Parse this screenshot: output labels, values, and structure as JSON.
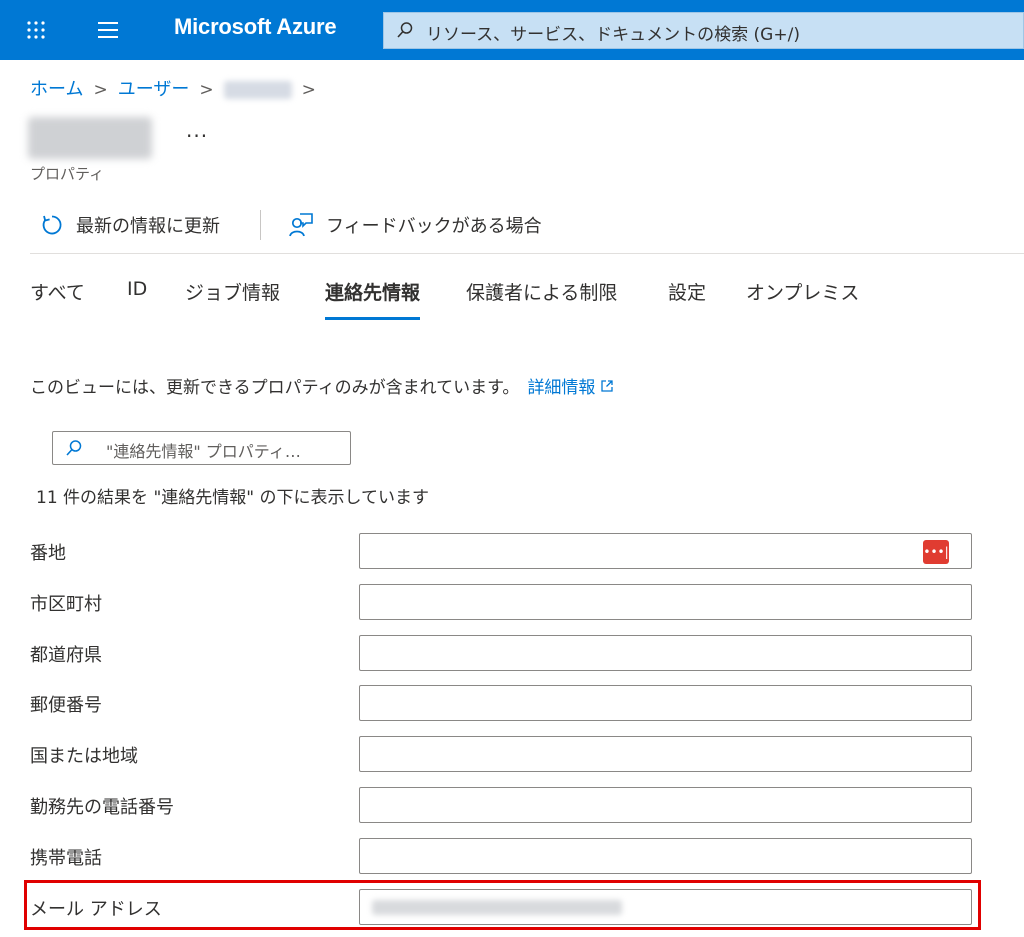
{
  "header": {
    "brand": "Microsoft Azure",
    "search_placeholder": "リソース、サービス、ドキュメントの検索 (G+/)",
    "icons": [
      "waffle-icon",
      "hamburger-icon",
      "search-icon"
    ]
  },
  "breadcrumb": {
    "items": [
      "ホーム",
      "ユーザー"
    ],
    "separator": ">"
  },
  "page": {
    "more": "···",
    "subtitle": "プロパティ"
  },
  "toolbar": {
    "refresh_label": "最新の情報に更新",
    "feedback_label": "フィードバックがある場合"
  },
  "tabs": [
    {
      "label": "すべて",
      "active": false
    },
    {
      "label": "ID",
      "active": false
    },
    {
      "label": "ジョブ情報",
      "active": false
    },
    {
      "label": "連絡先情報",
      "active": true
    },
    {
      "label": "保護者による制限",
      "active": false
    },
    {
      "label": "設定",
      "active": false
    },
    {
      "label": "オンプレミス",
      "active": false
    }
  ],
  "info": {
    "text": "このビューには、更新できるプロパティのみが含まれています。",
    "link": "詳細情報"
  },
  "filter": {
    "placeholder": "\"連絡先情報\" プロパティ…"
  },
  "results": {
    "text": "11 件の結果を \"連絡先情報\" の下に表示しています"
  },
  "fields": [
    {
      "label": "番地",
      "value": ""
    },
    {
      "label": "市区町村",
      "value": ""
    },
    {
      "label": "都道府県",
      "value": ""
    },
    {
      "label": "郵便番号",
      "value": ""
    },
    {
      "label": "国または地域",
      "value": ""
    },
    {
      "label": "勤務先の電話番号",
      "value": ""
    },
    {
      "label": "携帯電話",
      "value": ""
    },
    {
      "label": "メール アドレス",
      "value": ""
    }
  ],
  "colors": {
    "accent": "#0078d4",
    "highlight": "#e00000",
    "password_manager": "#e03c31"
  }
}
